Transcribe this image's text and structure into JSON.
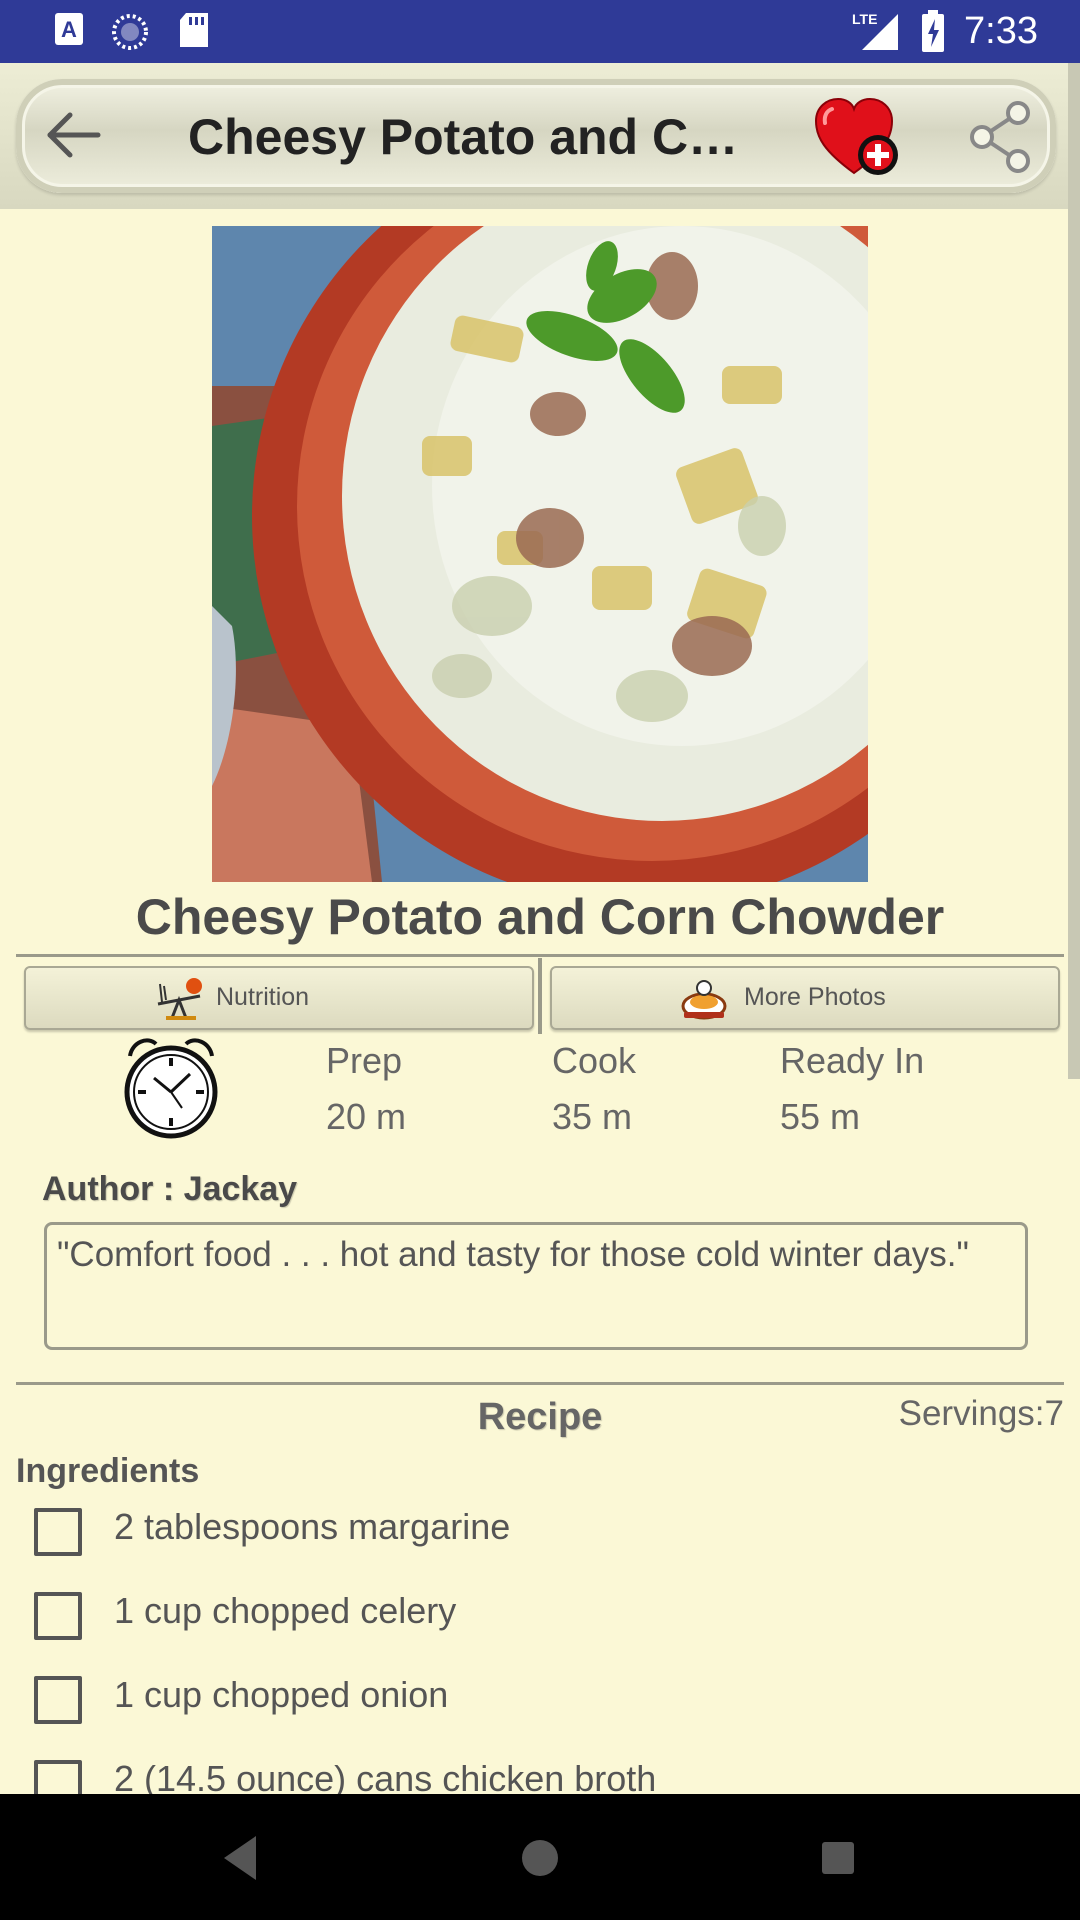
{
  "status_bar": {
    "time": "7:33",
    "network": "LTE",
    "icons": [
      "text-a-icon",
      "sync-icon",
      "sd-card-icon",
      "signal-icon",
      "battery-charging-icon"
    ]
  },
  "toolbar": {
    "title": "Cheesy Potato and Corn Chowder",
    "back_icon": "arrow-left-icon",
    "favorite_icon": "heart-plus-icon",
    "share_icon": "share-icon"
  },
  "recipe": {
    "title": "Cheesy Potato and Corn Chowder",
    "photo": "bowl of creamy potato and corn chowder",
    "buttons": {
      "nutrition": "Nutrition",
      "more_photos": "More Photos"
    },
    "times": {
      "prep_label": "Prep",
      "prep_value": "20 m",
      "cook_label": "Cook",
      "cook_value": "35 m",
      "ready_label": "Ready In",
      "ready_value": "55 m"
    },
    "author": "Author : Jackay",
    "description": "\"Comfort food . . . hot and tasty for those cold winter days.\"",
    "section_title": "Recipe",
    "servings": "Servings:7",
    "ingredients_title": "Ingredients",
    "ingredients": [
      "2 tablespoons margarine",
      "1 cup chopped celery",
      "1 cup chopped onion",
      "2 (14.5 ounce) cans chicken broth"
    ]
  },
  "colors": {
    "status_bar": "#2f3a97",
    "background": "#fbf8d6",
    "accent_red": "#e0101a"
  }
}
